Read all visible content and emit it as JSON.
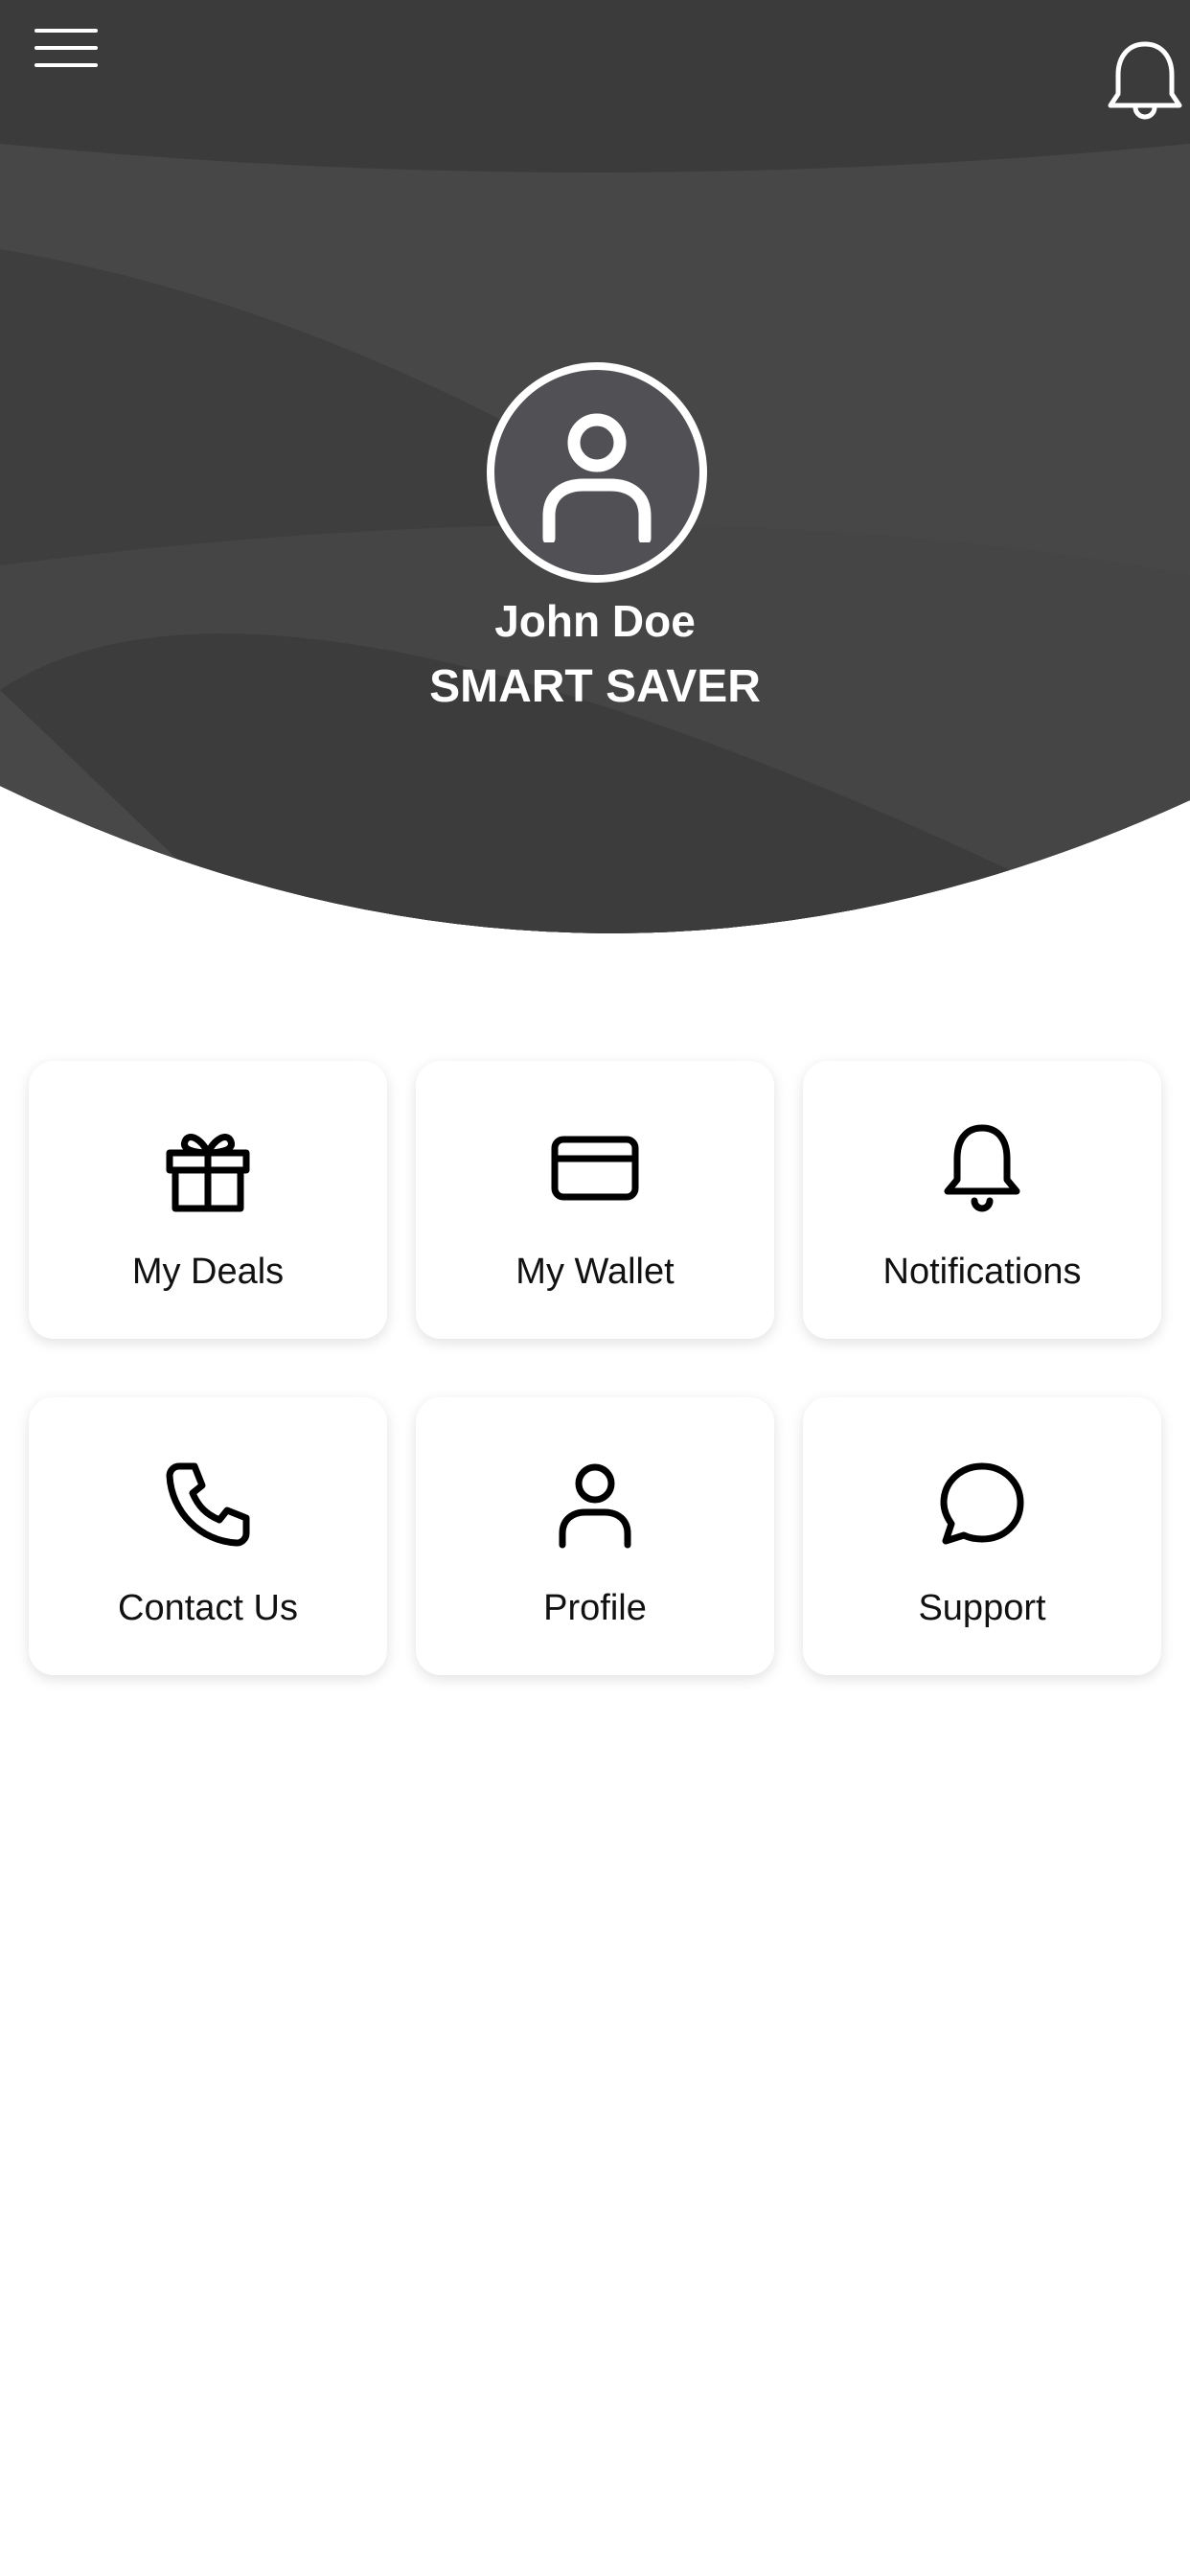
{
  "header": {
    "menu_icon": "hamburger-menu-icon",
    "bell_icon": "bell-icon",
    "background_color": "#3a3a3a"
  },
  "profile": {
    "avatar_icon": "user-avatar-icon",
    "name": "John Doe",
    "tier": "SMART SAVER"
  },
  "tiles": [
    {
      "label": "My Deals",
      "icon": "gift-icon"
    },
    {
      "label": "My Wallet",
      "icon": "credit-card-icon"
    },
    {
      "label": "Notifications",
      "icon": "bell-icon"
    },
    {
      "label": "Contact Us",
      "icon": "phone-icon"
    },
    {
      "label": "Profile",
      "icon": "user-icon"
    },
    {
      "label": "Support",
      "icon": "chat-bubble-icon"
    }
  ]
}
